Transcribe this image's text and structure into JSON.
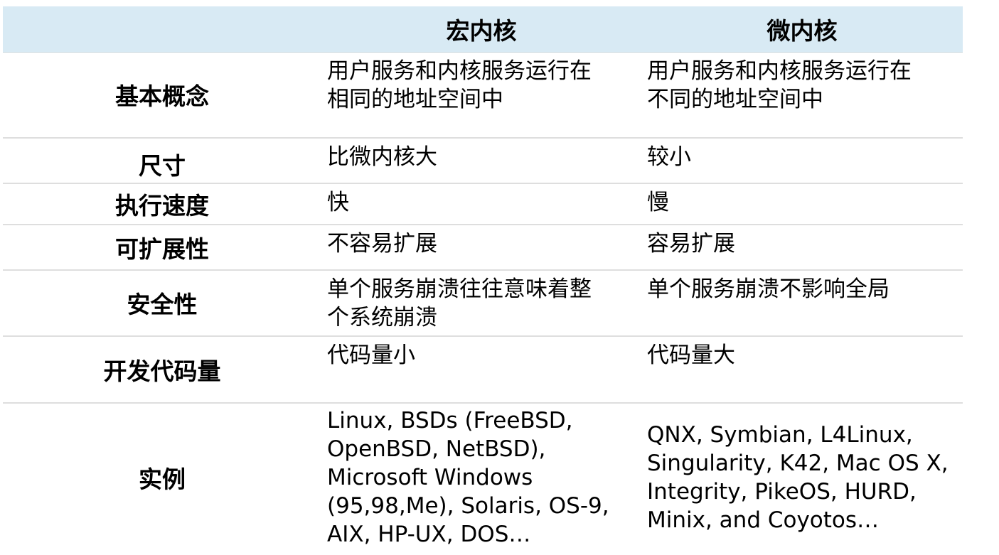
{
  "header": {
    "blank": "",
    "monolithic": "宏内核",
    "micro": "微内核"
  },
  "rows": [
    {
      "label": "基本概念",
      "monolithic": "用户服务和内核服务运行在\n相同的地址空间中",
      "micro": "用户服务和内核服务运行在\n不同的地址空间中"
    },
    {
      "label": "尺寸",
      "monolithic": "比微内核大",
      "micro": "较小"
    },
    {
      "label": "执行速度",
      "monolithic": "快",
      "micro": "慢"
    },
    {
      "label": "可扩展性",
      "monolithic": "不容易扩展",
      "micro": "容易扩展"
    },
    {
      "label": "安全性",
      "monolithic": "单个服务崩溃往往意味着整\n个系统崩溃",
      "micro": "单个服务崩溃不影响全局"
    },
    {
      "label": "开发代码量",
      "monolithic": "代码量小",
      "micro": "代码量大"
    },
    {
      "label": "实例",
      "monolithic": "Linux, BSDs (FreeBSD,\nOpenBSD, NetBSD),\nMicrosoft Windows\n(95,98,Me), Solaris, OS-9,\nAIX, HP-UX, DOS…",
      "micro": "QNX, Symbian, L4Linux,\nSingularity, K42, Mac OS X,\nIntegrity, PikeOS, HURD,\nMinix, and Coyotos…"
    }
  ]
}
